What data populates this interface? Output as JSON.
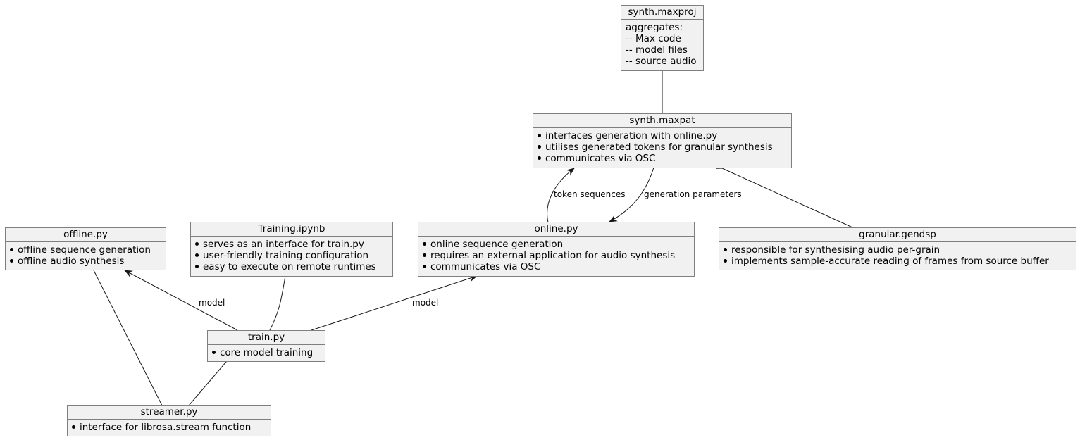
{
  "diagram": {
    "type": "uml-component-diagram",
    "nodes": {
      "synth_maxproj": {
        "title": "synth.maxproj",
        "style": "plain",
        "lines": [
          "aggregates:",
          "-- Max code",
          "-- model files",
          "-- source audio"
        ]
      },
      "synth_maxpat": {
        "title": "synth.maxpat",
        "style": "bullets",
        "lines": [
          "interfaces generation with online.py",
          "utilises generated tokens for granular synthesis",
          "communicates via OSC"
        ]
      },
      "offline_py": {
        "title": "offline.py",
        "style": "bullets",
        "lines": [
          "offline sequence generation",
          "offline audio synthesis"
        ]
      },
      "training_ipynb": {
        "title": "Training.ipynb",
        "style": "bullets",
        "lines": [
          "serves as an interface for train.py",
          "user-friendly training configuration",
          "easy to execute on remote runtimes"
        ]
      },
      "online_py": {
        "title": "online.py",
        "style": "bullets",
        "lines": [
          "online sequence generation",
          "requires an external application for audio synthesis",
          "communicates via OSC"
        ]
      },
      "granular_gendsp": {
        "title": "granular.gendsp",
        "style": "bullets",
        "lines": [
          "responsible for synthesising audio per-grain",
          "implements sample-accurate reading of frames from source buffer"
        ]
      },
      "train_py": {
        "title": "train.py",
        "style": "bullets",
        "lines": [
          "core model training"
        ]
      },
      "streamer_py": {
        "title": "streamer.py",
        "style": "bullets",
        "lines": [
          "interface for librosa.stream function"
        ]
      }
    },
    "edges": [
      {
        "from": "synth_maxproj",
        "to": "synth_maxpat",
        "kind": "aggregation",
        "label": ""
      },
      {
        "from": "online_py",
        "to": "synth_maxpat",
        "kind": "arrow",
        "label": "token sequences"
      },
      {
        "from": "synth_maxpat",
        "to": "online_py",
        "kind": "arrow",
        "label": "generation parameters"
      },
      {
        "from": "synth_maxpat",
        "to": "granular_gendsp",
        "kind": "aggregation",
        "label": ""
      },
      {
        "from": "train_py",
        "to": "offline_py",
        "kind": "arrow",
        "label": "model"
      },
      {
        "from": "training_ipynb",
        "to": "train_py",
        "kind": "aggregation",
        "label": ""
      },
      {
        "from": "train_py",
        "to": "online_py",
        "kind": "arrow",
        "label": "model"
      },
      {
        "from": "offline_py",
        "to": "streamer_py",
        "kind": "aggregation",
        "label": ""
      },
      {
        "from": "train_py",
        "to": "streamer_py",
        "kind": "aggregation",
        "label": ""
      }
    ],
    "colors": {
      "node_fill": "#f1f1f1",
      "node_border": "#7f7f7f",
      "edge": "#181818",
      "background": "#ffffff"
    }
  }
}
